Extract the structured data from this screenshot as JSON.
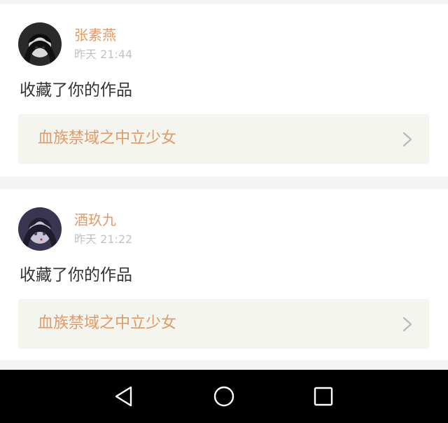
{
  "notifications": [
    {
      "username": "张素燕",
      "time": "昨天 21:44",
      "action": "收藏了你的作品",
      "work_title": "血族禁域之中立少女",
      "avatar_icon": "user-avatar-dark"
    },
    {
      "username": "酒玖九",
      "time": "昨天 21:22",
      "action": "收藏了你的作品",
      "work_title": "血族禁域之中立少女",
      "avatar_icon": "user-avatar-purple"
    }
  ],
  "colors": {
    "accent": "#e09a66",
    "text": "#333333",
    "muted": "#c2c2c2",
    "link_bg": "#f5f5ef",
    "page_bg": "#f4f4f4",
    "navbar_bg": "#000000"
  },
  "navbar": {
    "back_icon": "back-triangle-icon",
    "home_icon": "home-circle-icon",
    "recent_icon": "recent-square-icon"
  }
}
